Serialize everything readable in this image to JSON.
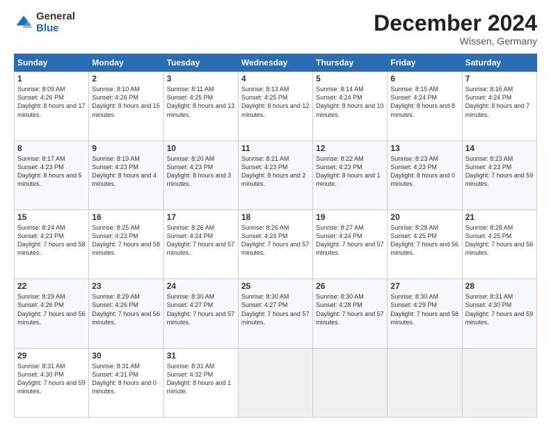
{
  "logo": {
    "general": "General",
    "blue": "Blue"
  },
  "title": "December 2024",
  "location": "Wissen, Germany",
  "days_header": [
    "Sunday",
    "Monday",
    "Tuesday",
    "Wednesday",
    "Thursday",
    "Friday",
    "Saturday"
  ],
  "weeks": [
    [
      {
        "day": "1",
        "sunrise": "8:09 AM",
        "sunset": "4:26 PM",
        "daylight": "8 hours and 17 minutes."
      },
      {
        "day": "2",
        "sunrise": "8:10 AM",
        "sunset": "4:26 PM",
        "daylight": "8 hours and 15 minutes."
      },
      {
        "day": "3",
        "sunrise": "8:11 AM",
        "sunset": "4:25 PM",
        "daylight": "8 hours and 13 minutes."
      },
      {
        "day": "4",
        "sunrise": "8:13 AM",
        "sunset": "4:25 PM",
        "daylight": "8 hours and 12 minutes."
      },
      {
        "day": "5",
        "sunrise": "8:14 AM",
        "sunset": "4:24 PM",
        "daylight": "8 hours and 10 minutes."
      },
      {
        "day": "6",
        "sunrise": "8:15 AM",
        "sunset": "4:24 PM",
        "daylight": "8 hours and 8 minutes."
      },
      {
        "day": "7",
        "sunrise": "8:16 AM",
        "sunset": "4:24 PM",
        "daylight": "8 hours and 7 minutes."
      }
    ],
    [
      {
        "day": "8",
        "sunrise": "8:17 AM",
        "sunset": "4:23 PM",
        "daylight": "8 hours and 5 minutes."
      },
      {
        "day": "9",
        "sunrise": "8:19 AM",
        "sunset": "4:23 PM",
        "daylight": "8 hours and 4 minutes."
      },
      {
        "day": "10",
        "sunrise": "8:20 AM",
        "sunset": "4:23 PM",
        "daylight": "8 hours and 3 minutes."
      },
      {
        "day": "11",
        "sunrise": "8:21 AM",
        "sunset": "4:23 PM",
        "daylight": "8 hours and 2 minutes."
      },
      {
        "day": "12",
        "sunrise": "8:22 AM",
        "sunset": "4:23 PM",
        "daylight": "8 hours and 1 minute."
      },
      {
        "day": "13",
        "sunrise": "8:23 AM",
        "sunset": "4:23 PM",
        "daylight": "8 hours and 0 minutes."
      },
      {
        "day": "14",
        "sunrise": "8:23 AM",
        "sunset": "4:23 PM",
        "daylight": "7 hours and 59 minutes."
      }
    ],
    [
      {
        "day": "15",
        "sunrise": "8:24 AM",
        "sunset": "4:23 PM",
        "daylight": "7 hours and 58 minutes."
      },
      {
        "day": "16",
        "sunrise": "8:25 AM",
        "sunset": "4:23 PM",
        "daylight": "7 hours and 58 minutes."
      },
      {
        "day": "17",
        "sunrise": "8:26 AM",
        "sunset": "4:24 PM",
        "daylight": "7 hours and 57 minutes."
      },
      {
        "day": "18",
        "sunrise": "8:26 AM",
        "sunset": "4:24 PM",
        "daylight": "7 hours and 57 minutes."
      },
      {
        "day": "19",
        "sunrise": "8:27 AM",
        "sunset": "4:24 PM",
        "daylight": "7 hours and 57 minutes."
      },
      {
        "day": "20",
        "sunrise": "8:28 AM",
        "sunset": "4:25 PM",
        "daylight": "7 hours and 56 minutes."
      },
      {
        "day": "21",
        "sunrise": "8:28 AM",
        "sunset": "4:25 PM",
        "daylight": "7 hours and 56 minutes."
      }
    ],
    [
      {
        "day": "22",
        "sunrise": "8:29 AM",
        "sunset": "4:26 PM",
        "daylight": "7 hours and 56 minutes."
      },
      {
        "day": "23",
        "sunrise": "8:29 AM",
        "sunset": "4:26 PM",
        "daylight": "7 hours and 56 minutes."
      },
      {
        "day": "24",
        "sunrise": "8:30 AM",
        "sunset": "4:27 PM",
        "daylight": "7 hours and 57 minutes."
      },
      {
        "day": "25",
        "sunrise": "8:30 AM",
        "sunset": "4:27 PM",
        "daylight": "7 hours and 57 minutes."
      },
      {
        "day": "26",
        "sunrise": "8:30 AM",
        "sunset": "4:28 PM",
        "daylight": "7 hours and 57 minutes."
      },
      {
        "day": "27",
        "sunrise": "8:30 AM",
        "sunset": "4:29 PM",
        "daylight": "7 hours and 58 minutes."
      },
      {
        "day": "28",
        "sunrise": "8:31 AM",
        "sunset": "4:30 PM",
        "daylight": "7 hours and 59 minutes."
      }
    ],
    [
      {
        "day": "29",
        "sunrise": "8:31 AM",
        "sunset": "4:30 PM",
        "daylight": "7 hours and 59 minutes."
      },
      {
        "day": "30",
        "sunrise": "8:31 AM",
        "sunset": "4:31 PM",
        "daylight": "8 hours and 0 minutes."
      },
      {
        "day": "31",
        "sunrise": "8:31 AM",
        "sunset": "4:32 PM",
        "daylight": "8 hours and 1 minute."
      },
      null,
      null,
      null,
      null
    ]
  ]
}
